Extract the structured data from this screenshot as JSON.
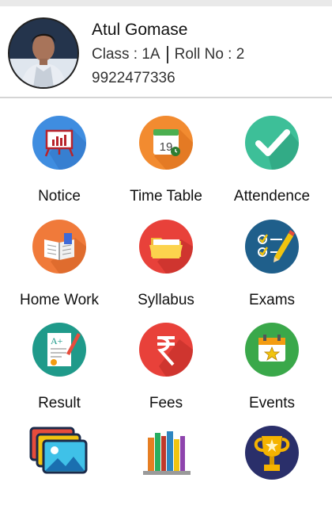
{
  "profile": {
    "name": "Atul Gomase",
    "class_label": "Class : 1A",
    "roll_label": "Roll No : 2",
    "phone": "9922477336"
  },
  "menu": [
    {
      "label": "Notice",
      "icon": "notice-board-icon",
      "color": "#3f8de0"
    },
    {
      "label": "Time Table",
      "icon": "calendar-icon",
      "color": "#f28b30"
    },
    {
      "label": "Attendence",
      "icon": "checkmark-icon",
      "color": "#3dbf98"
    },
    {
      "label": "Home Work",
      "icon": "open-book-icon",
      "color": "#f07a3a"
    },
    {
      "label": "Syllabus",
      "icon": "folder-icon",
      "color": "#e8413a"
    },
    {
      "label": "Exams",
      "icon": "checklist-pencil-icon",
      "color": "#1f5f8b"
    },
    {
      "label": "Result",
      "icon": "report-card-icon",
      "color": "#1f9a8a"
    },
    {
      "label": "Fees",
      "icon": "rupee-icon",
      "color": "#e8413a"
    },
    {
      "label": "Events",
      "icon": "event-calendar-icon",
      "color": "#3aa84a"
    },
    {
      "label": "",
      "icon": "photo-gallery-icon",
      "color": "#1a2a4a"
    },
    {
      "label": "",
      "icon": "bookshelf-icon",
      "color": "#c8c8c8"
    },
    {
      "label": "",
      "icon": "trophy-icon",
      "color": "#2a2f6a"
    }
  ]
}
